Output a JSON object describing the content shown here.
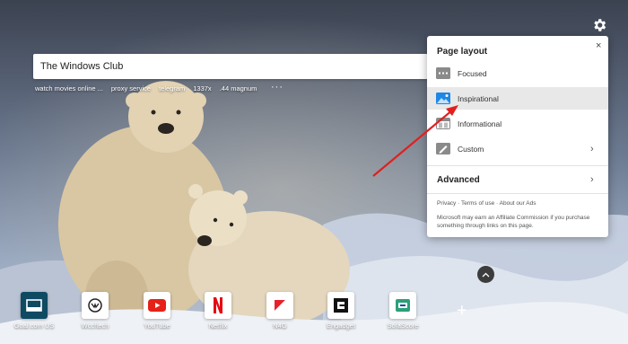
{
  "search": {
    "value": "The Windows Club"
  },
  "quick_links": [
    "watch movies online ...",
    "proxy service",
    "telegram",
    "1337x",
    ".44 magnum"
  ],
  "more_label": "···",
  "panel": {
    "title": "Page layout",
    "close": "×",
    "options": [
      {
        "label": "Focused",
        "icon": "focused-icon"
      },
      {
        "label": "Inspirational",
        "icon": "inspirational-icon",
        "selected": true
      },
      {
        "label": "Informational",
        "icon": "informational-icon"
      },
      {
        "label": "Custom",
        "icon": "custom-icon",
        "chevron": "›"
      }
    ],
    "advanced": "Advanced",
    "advanced_chevron": "›",
    "footer": {
      "privacy": "Privacy",
      "terms": "Terms of use",
      "about": "About our Ads",
      "note": "Microsoft may earn an Affiliate Commission if you purchase something through links on this page."
    }
  },
  "tiles": [
    {
      "label": "Goal.com US",
      "icon": "goal-icon"
    },
    {
      "label": "Wccftech",
      "icon": "wccftech-icon"
    },
    {
      "label": "YouTube",
      "icon": "youtube-icon"
    },
    {
      "label": "Netflix",
      "icon": "netflix-icon"
    },
    {
      "label": "N4G",
      "icon": "n4g-icon"
    },
    {
      "label": "Engadget",
      "icon": "engadget-icon"
    },
    {
      "label": "SofaScore",
      "icon": "sofascore-icon"
    }
  ],
  "add_tile": "+",
  "scroll_up": "^",
  "colors": {
    "accent": "#0078d4",
    "annotation_arrow": "#e02020",
    "selected_row": "#e8e8e8"
  }
}
